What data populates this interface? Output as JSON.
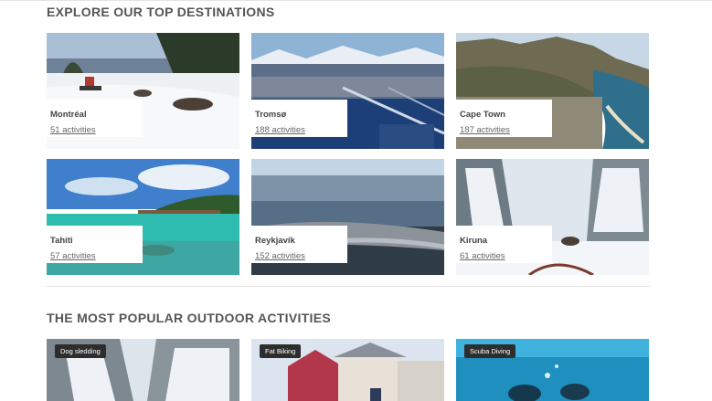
{
  "sections": {
    "destinations_title": "EXPLORE OUR TOP DESTINATIONS",
    "activities_title": "THE MOST POPULAR OUTDOOR ACTIVITIES"
  },
  "destinations": [
    {
      "city": "Montréal",
      "activities": "51 activities"
    },
    {
      "city": "Tromsø",
      "activities": "188 activities"
    },
    {
      "city": "Cape Town",
      "activities": "187 activities"
    },
    {
      "city": "Tahiti",
      "activities": "57 activities"
    },
    {
      "city": "Reykjavík",
      "activities": "152 activities"
    },
    {
      "city": "Kiruna",
      "activities": "61 activities"
    }
  ],
  "activities": [
    {
      "tag": "Dog sledding"
    },
    {
      "tag": "Fat Biking"
    },
    {
      "tag": "Scuba Diving"
    }
  ]
}
